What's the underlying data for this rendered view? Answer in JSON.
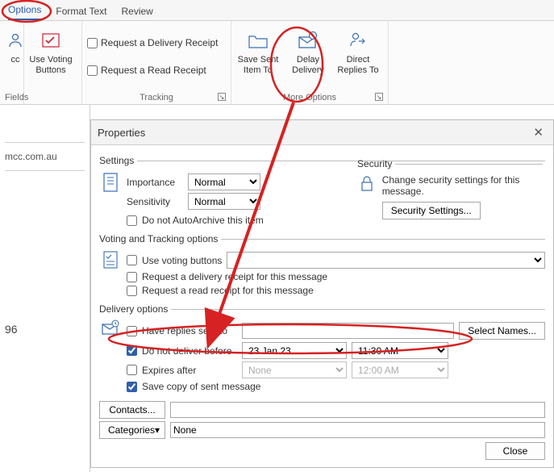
{
  "tabs": {
    "options": "Options",
    "format": "Format Text",
    "review": "Review"
  },
  "ribbon": {
    "fields_group": "Fields",
    "bcc": "cc",
    "voting_btn": "Use Voting\nButtons",
    "tracking_group": "Tracking",
    "req_delivery": "Request a Delivery Receipt",
    "req_read": "Request a Read Receipt",
    "save_sent": "Save Sent\nItem To",
    "delay": "Delay\nDelivery",
    "direct": "Direct\nReplies To",
    "more_options": "More Options"
  },
  "leftstrip": {
    "addr": "mcc.com.au",
    "num": "96"
  },
  "dialog": {
    "title": "Properties",
    "settings": "Settings",
    "importance_label": "Importance",
    "importance_value": "Normal",
    "sensitivity_label": "Sensitivity",
    "sensitivity_value": "Normal",
    "noautoarchive": "Do not AutoArchive this item",
    "security": "Security",
    "security_text": "Change security settings for this message.",
    "security_btn": "Security Settings...",
    "voting_legend": "Voting and Tracking options",
    "use_voting": "Use voting buttons",
    "req_delivery": "Request a delivery receipt for this message",
    "req_read": "Request a read receipt for this message",
    "delivery_legend": "Delivery options",
    "have_replies": "Have replies sent to",
    "select_names": "Select Names...",
    "do_not_before": "Do not deliver before",
    "date_value": "23 Jan 23",
    "time_value": "11:30 AM",
    "expires_after": "Expires after",
    "expires_date": "None",
    "expires_time": "12:00 AM",
    "save_copy": "Save copy of sent message",
    "contacts": "Contacts...",
    "categories": "Categories",
    "categories_value": "None",
    "close": "Close"
  }
}
